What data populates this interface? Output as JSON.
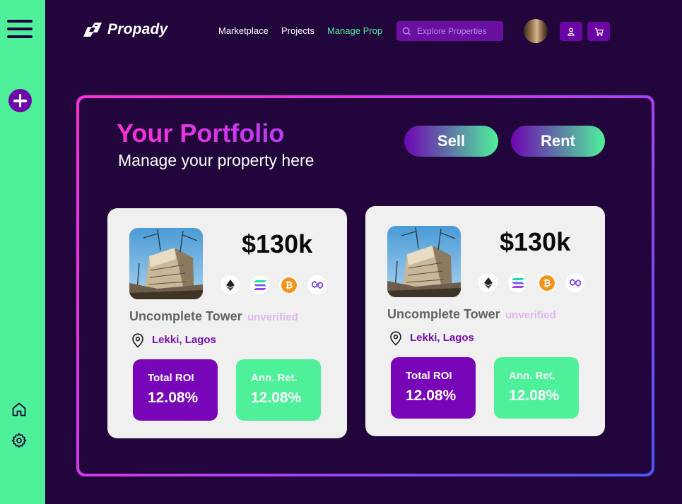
{
  "app": {
    "brand": "Propady"
  },
  "nav": [
    {
      "label": "Marketplace"
    },
    {
      "label": "Projects"
    },
    {
      "label": "Manage Prop"
    }
  ],
  "search": {
    "placeholder": "Explore Properties"
  },
  "sidebar": {
    "icons": [
      "menu-icon",
      "add-icon",
      "home-icon",
      "settings-icon"
    ]
  },
  "header_icons": [
    "user-icon",
    "cart-icon"
  ],
  "portfolio": {
    "title": "Your Portfolio",
    "subtitle": "Manage your property here",
    "sell_label": "Sell",
    "rent_label": "Rent"
  },
  "cards": [
    {
      "price": "$130k",
      "name": "Uncomplete Tower",
      "status": "unverified",
      "location": "Lekki, Lagos",
      "roi_label": "Total ROI",
      "roi_value": "12.08%",
      "ret_label": "Ann. Ret.",
      "ret_value": "12.08%",
      "tokens": [
        "ethereum-icon",
        "solana-icon",
        "bitcoin-icon",
        "polygon-icon"
      ]
    },
    {
      "price": "$130k",
      "name": "Uncomplete Tower",
      "status": "unverified",
      "location": "Lekki, Lagos",
      "roi_label": "Total ROI",
      "roi_value": "12.08%",
      "ret_label": "Ann. Ret.",
      "ret_value": "12.08%",
      "tokens": [
        "ethereum-icon",
        "solana-icon",
        "bitcoin-icon",
        "polygon-icon"
      ]
    }
  ],
  "colors": {
    "background": "#22053a",
    "sidebar": "#4ef09a",
    "accent_purple": "#7905b8",
    "accent_green": "#4ef09a",
    "title_pink": "#ff2fd9",
    "location_purple": "#7311ab"
  }
}
